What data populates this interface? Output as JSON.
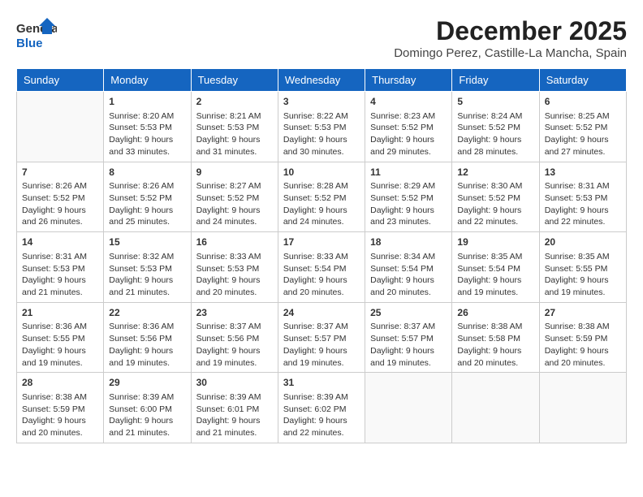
{
  "header": {
    "logo_general": "General",
    "logo_blue": "Blue",
    "month_title": "December 2025",
    "subtitle": "Domingo Perez, Castille-La Mancha, Spain"
  },
  "days_of_week": [
    "Sunday",
    "Monday",
    "Tuesday",
    "Wednesday",
    "Thursday",
    "Friday",
    "Saturday"
  ],
  "weeks": [
    [
      {
        "day": "",
        "sunrise": "",
        "sunset": "",
        "daylight": ""
      },
      {
        "day": "1",
        "sunrise": "Sunrise: 8:20 AM",
        "sunset": "Sunset: 5:53 PM",
        "daylight": "Daylight: 9 hours and 33 minutes."
      },
      {
        "day": "2",
        "sunrise": "Sunrise: 8:21 AM",
        "sunset": "Sunset: 5:53 PM",
        "daylight": "Daylight: 9 hours and 31 minutes."
      },
      {
        "day": "3",
        "sunrise": "Sunrise: 8:22 AM",
        "sunset": "Sunset: 5:53 PM",
        "daylight": "Daylight: 9 hours and 30 minutes."
      },
      {
        "day": "4",
        "sunrise": "Sunrise: 8:23 AM",
        "sunset": "Sunset: 5:52 PM",
        "daylight": "Daylight: 9 hours and 29 minutes."
      },
      {
        "day": "5",
        "sunrise": "Sunrise: 8:24 AM",
        "sunset": "Sunset: 5:52 PM",
        "daylight": "Daylight: 9 hours and 28 minutes."
      },
      {
        "day": "6",
        "sunrise": "Sunrise: 8:25 AM",
        "sunset": "Sunset: 5:52 PM",
        "daylight": "Daylight: 9 hours and 27 minutes."
      }
    ],
    [
      {
        "day": "7",
        "sunrise": "Sunrise: 8:26 AM",
        "sunset": "Sunset: 5:52 PM",
        "daylight": "Daylight: 9 hours and 26 minutes."
      },
      {
        "day": "8",
        "sunrise": "Sunrise: 8:26 AM",
        "sunset": "Sunset: 5:52 PM",
        "daylight": "Daylight: 9 hours and 25 minutes."
      },
      {
        "day": "9",
        "sunrise": "Sunrise: 8:27 AM",
        "sunset": "Sunset: 5:52 PM",
        "daylight": "Daylight: 9 hours and 24 minutes."
      },
      {
        "day": "10",
        "sunrise": "Sunrise: 8:28 AM",
        "sunset": "Sunset: 5:52 PM",
        "daylight": "Daylight: 9 hours and 24 minutes."
      },
      {
        "day": "11",
        "sunrise": "Sunrise: 8:29 AM",
        "sunset": "Sunset: 5:52 PM",
        "daylight": "Daylight: 9 hours and 23 minutes."
      },
      {
        "day": "12",
        "sunrise": "Sunrise: 8:30 AM",
        "sunset": "Sunset: 5:52 PM",
        "daylight": "Daylight: 9 hours and 22 minutes."
      },
      {
        "day": "13",
        "sunrise": "Sunrise: 8:31 AM",
        "sunset": "Sunset: 5:53 PM",
        "daylight": "Daylight: 9 hours and 22 minutes."
      }
    ],
    [
      {
        "day": "14",
        "sunrise": "Sunrise: 8:31 AM",
        "sunset": "Sunset: 5:53 PM",
        "daylight": "Daylight: 9 hours and 21 minutes."
      },
      {
        "day": "15",
        "sunrise": "Sunrise: 8:32 AM",
        "sunset": "Sunset: 5:53 PM",
        "daylight": "Daylight: 9 hours and 21 minutes."
      },
      {
        "day": "16",
        "sunrise": "Sunrise: 8:33 AM",
        "sunset": "Sunset: 5:53 PM",
        "daylight": "Daylight: 9 hours and 20 minutes."
      },
      {
        "day": "17",
        "sunrise": "Sunrise: 8:33 AM",
        "sunset": "Sunset: 5:54 PM",
        "daylight": "Daylight: 9 hours and 20 minutes."
      },
      {
        "day": "18",
        "sunrise": "Sunrise: 8:34 AM",
        "sunset": "Sunset: 5:54 PM",
        "daylight": "Daylight: 9 hours and 20 minutes."
      },
      {
        "day": "19",
        "sunrise": "Sunrise: 8:35 AM",
        "sunset": "Sunset: 5:54 PM",
        "daylight": "Daylight: 9 hours and 19 minutes."
      },
      {
        "day": "20",
        "sunrise": "Sunrise: 8:35 AM",
        "sunset": "Sunset: 5:55 PM",
        "daylight": "Daylight: 9 hours and 19 minutes."
      }
    ],
    [
      {
        "day": "21",
        "sunrise": "Sunrise: 8:36 AM",
        "sunset": "Sunset: 5:55 PM",
        "daylight": "Daylight: 9 hours and 19 minutes."
      },
      {
        "day": "22",
        "sunrise": "Sunrise: 8:36 AM",
        "sunset": "Sunset: 5:56 PM",
        "daylight": "Daylight: 9 hours and 19 minutes."
      },
      {
        "day": "23",
        "sunrise": "Sunrise: 8:37 AM",
        "sunset": "Sunset: 5:56 PM",
        "daylight": "Daylight: 9 hours and 19 minutes."
      },
      {
        "day": "24",
        "sunrise": "Sunrise: 8:37 AM",
        "sunset": "Sunset: 5:57 PM",
        "daylight": "Daylight: 9 hours and 19 minutes."
      },
      {
        "day": "25",
        "sunrise": "Sunrise: 8:37 AM",
        "sunset": "Sunset: 5:57 PM",
        "daylight": "Daylight: 9 hours and 19 minutes."
      },
      {
        "day": "26",
        "sunrise": "Sunrise: 8:38 AM",
        "sunset": "Sunset: 5:58 PM",
        "daylight": "Daylight: 9 hours and 20 minutes."
      },
      {
        "day": "27",
        "sunrise": "Sunrise: 8:38 AM",
        "sunset": "Sunset: 5:59 PM",
        "daylight": "Daylight: 9 hours and 20 minutes."
      }
    ],
    [
      {
        "day": "28",
        "sunrise": "Sunrise: 8:38 AM",
        "sunset": "Sunset: 5:59 PM",
        "daylight": "Daylight: 9 hours and 20 minutes."
      },
      {
        "day": "29",
        "sunrise": "Sunrise: 8:39 AM",
        "sunset": "Sunset: 6:00 PM",
        "daylight": "Daylight: 9 hours and 21 minutes."
      },
      {
        "day": "30",
        "sunrise": "Sunrise: 8:39 AM",
        "sunset": "Sunset: 6:01 PM",
        "daylight": "Daylight: 9 hours and 21 minutes."
      },
      {
        "day": "31",
        "sunrise": "Sunrise: 8:39 AM",
        "sunset": "Sunset: 6:02 PM",
        "daylight": "Daylight: 9 hours and 22 minutes."
      },
      {
        "day": "",
        "sunrise": "",
        "sunset": "",
        "daylight": ""
      },
      {
        "day": "",
        "sunrise": "",
        "sunset": "",
        "daylight": ""
      },
      {
        "day": "",
        "sunrise": "",
        "sunset": "",
        "daylight": ""
      }
    ]
  ]
}
